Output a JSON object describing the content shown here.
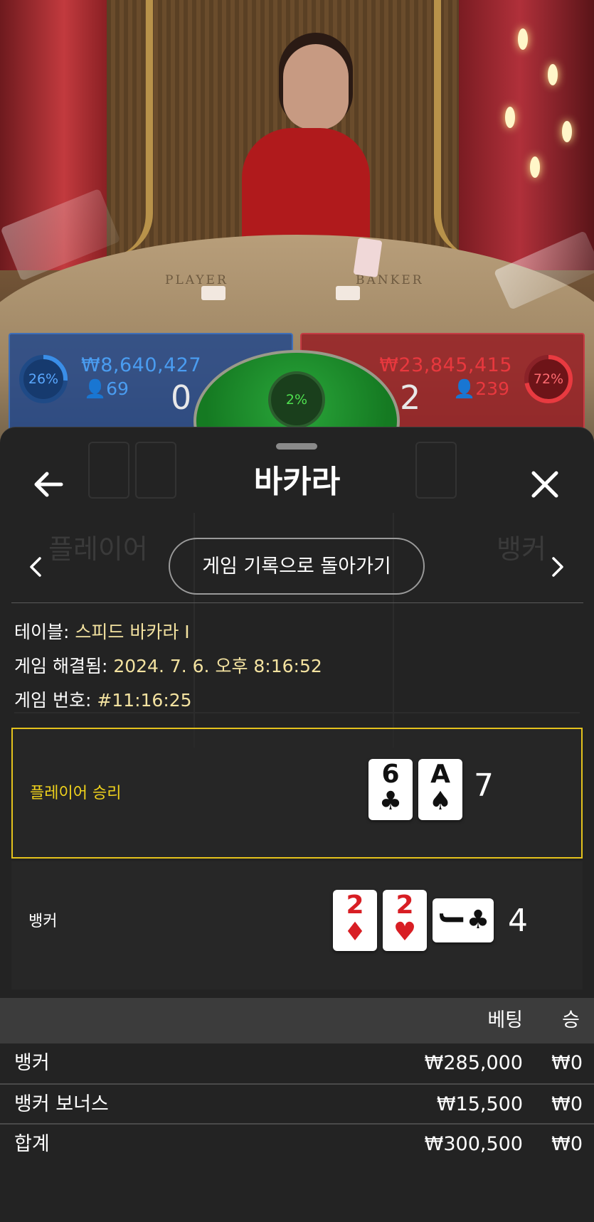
{
  "video": {
    "felt_player": "PLAYER",
    "felt_banker": "BANKER"
  },
  "scoreboard": {
    "player": {
      "percent": "26%",
      "percent_value": 26,
      "amount": "₩8,640,427",
      "players": "69",
      "score": "0",
      "color": "#3a8ee8"
    },
    "tie": {
      "percent": "2%",
      "percent_value": 2,
      "color": "#3fd43f"
    },
    "banker": {
      "percent": "72%",
      "percent_value": 72,
      "amount": "₩23,845,415",
      "players": "239",
      "score": "2",
      "color": "#e83a40"
    }
  },
  "sheet": {
    "title": "바카라",
    "back_icon": "arrow-left-icon",
    "close_icon": "close-icon",
    "history_button": "게임 기록으로 돌아가기",
    "background_ghost": {
      "left_label": "플레이어",
      "right_label": "뱅커"
    },
    "info": {
      "table_label": "테이블:",
      "table_value": "스피드 바카라 I",
      "resolved_label": "게임 해결됨:",
      "resolved_value": "2024. 7. 6. 오후 8:16:52",
      "number_label": "게임 번호:",
      "number_value": "#11:16:25"
    },
    "results": {
      "player": {
        "label": "플레이어 승리",
        "label_color": "#f0d21c",
        "highlight_color": "#e4c21c",
        "cards": [
          {
            "rank": "6",
            "suit": "♣",
            "color": "black"
          },
          {
            "rank": "A",
            "suit": "♠",
            "color": "black"
          }
        ],
        "total": "7"
      },
      "banker": {
        "label": "뱅커",
        "cards": [
          {
            "rank": "2",
            "suit": "♦",
            "color": "red"
          },
          {
            "rank": "2",
            "suit": "♥",
            "color": "red"
          },
          {
            "rank": "J",
            "suit": "♣",
            "color": "black",
            "sideways": true
          }
        ],
        "total": "4"
      }
    },
    "bets": {
      "header_bet": "베팅",
      "header_win": "승",
      "rows": [
        {
          "name": "뱅커",
          "amount": "₩285,000",
          "win": "₩0"
        },
        {
          "name": "뱅커 보너스",
          "amount": "₩15,500",
          "win": "₩0"
        },
        {
          "name": "합계",
          "amount": "₩300,500",
          "win": "₩0"
        }
      ]
    }
  }
}
